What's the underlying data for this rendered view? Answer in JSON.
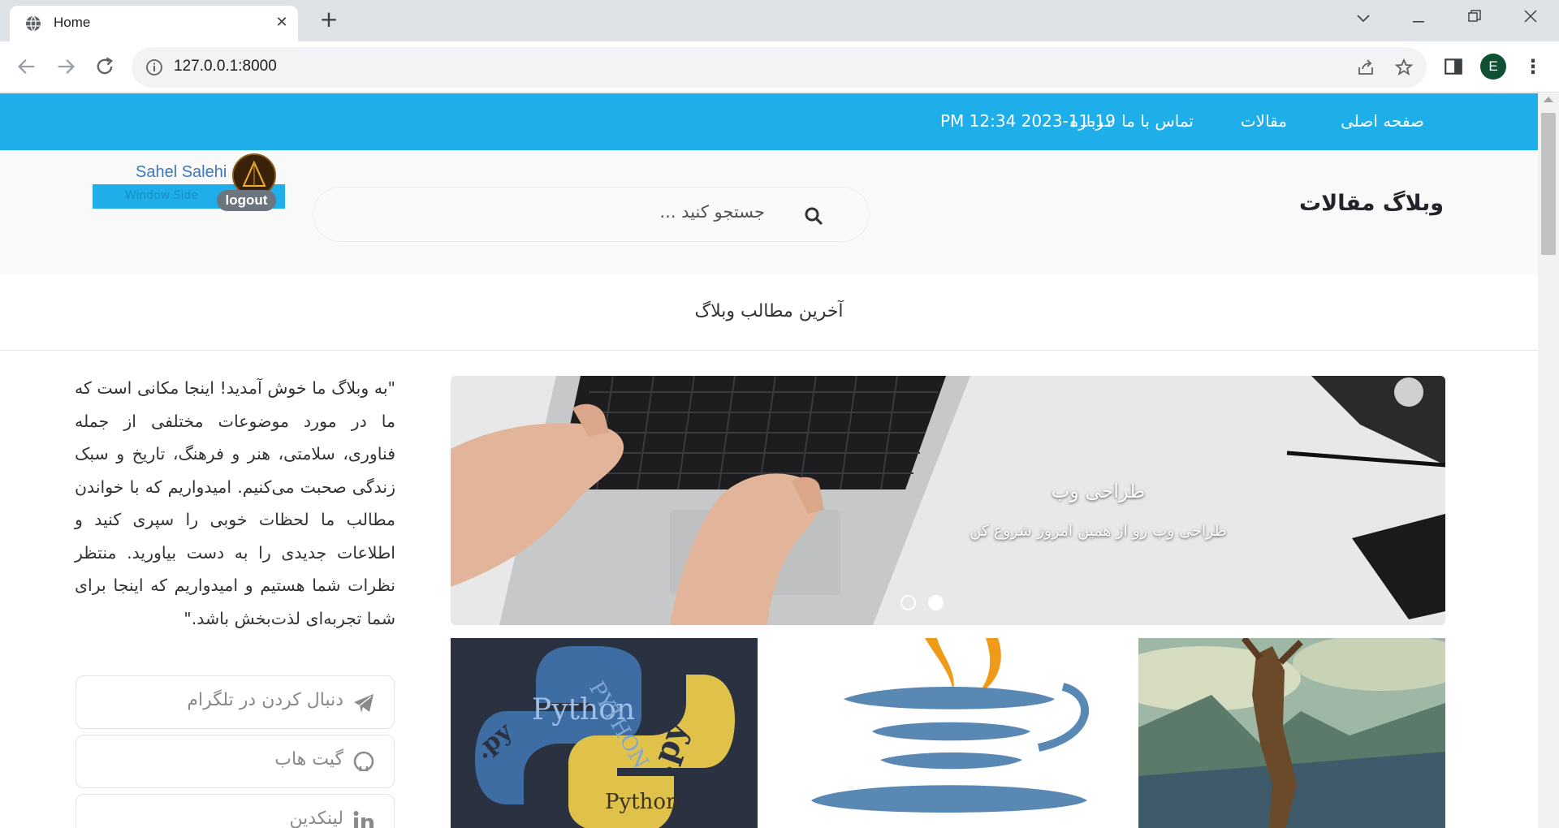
{
  "browser": {
    "tab_title": "Home",
    "url": "127.0.0.1:8000",
    "profile_initial": "E"
  },
  "nav": {
    "items": [
      "صفحه اصلی",
      "مقالات",
      "تماس با ما",
      "درباره"
    ],
    "datetime": "PM 12:34 2023-11-19"
  },
  "header": {
    "site_title": "وبلاگ مقالات",
    "search_placeholder": "جستجو کنید ...",
    "user_name": "Sahel Salehi",
    "logout_label": "logout",
    "watermark": "Window Side"
  },
  "main": {
    "section_title": "آخرین مطالب وبلاگ",
    "carousel": {
      "title": "طراحی وب",
      "subtitle": "طراحی وب رو از همین امروز شروع کن"
    },
    "cards": [
      {
        "image": "python-wordcloud"
      },
      {
        "image": "java-logo"
      },
      {
        "image": "colossus-statue"
      }
    ]
  },
  "sidebar": {
    "intro_text": "\"به وبلاگ ما خوش آمدید! اینجا مکانی است که ما در مورد موضوعات مختلفی از جمله فناوری، سلامتی، هنر و فرهنگ، تاریخ و سبک زندگی صحبت می‌کنیم. امیدواریم که با خواندن مطالب ما لحظات خوبی را سپری کنید و اطلاعات جدیدی را به دست بیاورید. منتظر نظرات شما هستیم و امیدواریم که اینجا برای شما تجربه‌ای لذت‌بخش باشد.\"",
    "social": [
      {
        "label": "دنبال کردن در تلگرام",
        "icon": "telegram-icon"
      },
      {
        "label": "گیت هاب",
        "icon": "github-icon"
      },
      {
        "label": "لینکدین",
        "icon": "linkedin-icon"
      }
    ]
  },
  "colors": {
    "nav_bg": "#1eaeea",
    "header_bg": "#f9f9f9",
    "accent_link": "#3c78b8"
  }
}
